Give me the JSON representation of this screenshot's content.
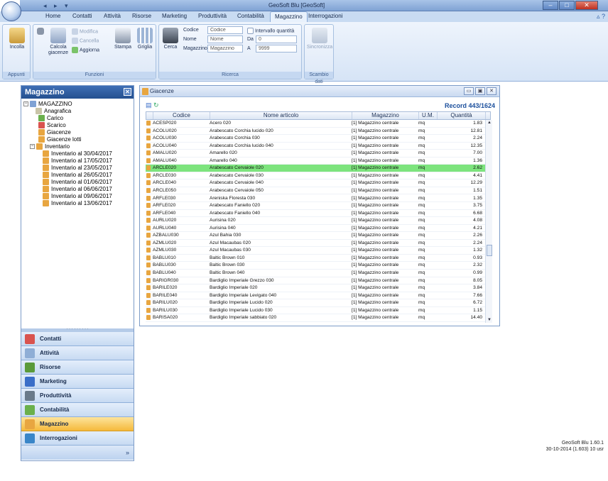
{
  "titlebar": {
    "title": "GeoSoft Blu [GeoSoft]"
  },
  "tabs": [
    {
      "label": "Home"
    },
    {
      "label": "Contatti"
    },
    {
      "label": "Attività"
    },
    {
      "label": "Risorse"
    },
    {
      "label": "Marketing"
    },
    {
      "label": "Produttività"
    },
    {
      "label": "Contabilità"
    },
    {
      "label": "Magazzino"
    },
    {
      "label": "Interrogazioni"
    }
  ],
  "ribbon": {
    "appunti": {
      "title": "Appunti",
      "incolla": "Incolla"
    },
    "funzioni": {
      "title": "Funzioni",
      "modifica": "Modifica",
      "cancella": "Cancella",
      "aggiorna": "Aggiorna",
      "calcola_giacenze": "Calcola giacenze",
      "stampa": "Stampa",
      "griglia": "Griglia"
    },
    "ricerca": {
      "title": "Ricerca",
      "cerca": "Cerca",
      "codice_label": "Codice",
      "codice_value": "Codice",
      "nome_label": "Nome",
      "nome_value": "Nome",
      "magazzino_label": "Magazzino",
      "magazzino_value": "Magazzino",
      "intervallo_label": "Intervallo quantità",
      "da_label": "Da",
      "da_value": "0",
      "a_label": "A",
      "a_value": "9999"
    },
    "scambio": {
      "title": "Scambio dati",
      "sincronizza": "Sincronizza"
    }
  },
  "left_panel": {
    "title": "Magazzino",
    "tree": [
      {
        "label": "MAGAZZINO"
      },
      {
        "label": "Anagrafica"
      },
      {
        "label": "Carico"
      },
      {
        "label": "Scarico"
      },
      {
        "label": "Giacenze"
      },
      {
        "label": "Giacenze lotti"
      },
      {
        "label": "Inventario"
      },
      {
        "label": "Inventario al 30/04/2017"
      },
      {
        "label": "Inventario al 17/05/2017"
      },
      {
        "label": "Inventario al 23/05/2017"
      },
      {
        "label": "Inventario al 26/05/2017"
      },
      {
        "label": "Inventario al 01/06/2017"
      },
      {
        "label": "Inventario al 06/06/2017"
      },
      {
        "label": "Inventario al 09/06/2017"
      },
      {
        "label": "Inventario al 13/06/2017"
      }
    ],
    "nav": [
      {
        "label": "Contatti",
        "color": "#d9534f"
      },
      {
        "label": "Attività",
        "color": "#8faed6"
      },
      {
        "label": "Risorse",
        "color": "#5a9a3a"
      },
      {
        "label": "Marketing",
        "color": "#3a6ec8"
      },
      {
        "label": "Produttività",
        "color": "#6a7a8a"
      },
      {
        "label": "Contabilità",
        "color": "#6ab04c"
      },
      {
        "label": "Magazzino",
        "color": "#e8a640"
      },
      {
        "label": "Interrogazioni",
        "color": "#3a86c8"
      }
    ]
  },
  "grid_window": {
    "title": "Giacenze",
    "record": "Record 443/1624",
    "columns": [
      "Codice",
      "Nome articolo",
      "Magazzino",
      "U.M.",
      "Quantità"
    ],
    "rows": [
      [
        "ACESP020",
        "Acero 020",
        "[1] Magazzino centrale",
        "mq",
        "1.83"
      ],
      [
        "ACOLU020",
        "Arabescato Corchia lucido 020",
        "[1] Magazzino centrale",
        "mq",
        "12.81"
      ],
      [
        "ACOLU030",
        "Arabescato Corchia 030",
        "[1] Magazzino centrale",
        "mq",
        "2.24"
      ],
      [
        "ACOLU040",
        "Arabescato Corchia lucido 040",
        "[1] Magazzino centrale",
        "mq",
        "12.35"
      ],
      [
        "AMALU020",
        "Amarello 020",
        "[1] Magazzino centrale",
        "mq",
        "7.00"
      ],
      [
        "AMALU040",
        "Amarello 040",
        "[1] Magazzino centrale",
        "mq",
        "1.36"
      ],
      [
        "ARCLE020",
        "Arabescato Cervaiole 020",
        "[1] Magazzino centrale",
        "mq",
        "2.62"
      ],
      [
        "ARCLE030",
        "Arabescato Cervaiole 030",
        "[1] Magazzino centrale",
        "mq",
        "4.41"
      ],
      [
        "ARCLE040",
        "Arabescato Cervaiole 040",
        "[1] Magazzino centrale",
        "mq",
        "12.29"
      ],
      [
        "ARCLE050",
        "Arabescato Cervaiole 050",
        "[1] Magazzino centrale",
        "mq",
        "1.51"
      ],
      [
        "ARFLE030",
        "Areniska Floresta 030",
        "[1] Magazzino centrale",
        "mq",
        "1.35"
      ],
      [
        "ARFLE020",
        "Arabescato Faniello 020",
        "[1] Magazzino centrale",
        "mq",
        "3.75"
      ],
      [
        "ARFLE040",
        "Arabescato Faniello 040",
        "[1] Magazzino centrale",
        "mq",
        "6.68"
      ],
      [
        "AURLU020",
        "Aurisina 020",
        "[1] Magazzino centrale",
        "mq",
        "4.08"
      ],
      [
        "AURLU040",
        "Aurisina 040",
        "[1] Magazzino centrale",
        "mq",
        "4.21"
      ],
      [
        "AZBALU030",
        "Azul Bahia 030",
        "[1] Magazzino centrale",
        "mq",
        "2.26"
      ],
      [
        "AZMLU020",
        "Azul Macaubas 020",
        "[1] Magazzino centrale",
        "mq",
        "2.24"
      ],
      [
        "AZMLU030",
        "Azul Macaubas 030",
        "[1] Magazzino centrale",
        "mq",
        "1.32"
      ],
      [
        "BABLU010",
        "Baltic Brown 010",
        "[1] Magazzino centrale",
        "mq",
        "0.93"
      ],
      [
        "BABLU030",
        "Baltic Brown 030",
        "[1] Magazzino centrale",
        "mq",
        "2.32"
      ],
      [
        "BABLU040",
        "Baltic Brown 040",
        "[1] Magazzino centrale",
        "mq",
        "0.99"
      ],
      [
        "BARIGR030",
        "Bardiglio Imperiale Grezzo 030",
        "[1] Magazzino centrale",
        "mq",
        "8.05"
      ],
      [
        "BARILE020",
        "Bardiglio Imperiale 020",
        "[1] Magazzino centrale",
        "mq",
        "3.84"
      ],
      [
        "BARILE040",
        "Bardiglio Imperiale Levigato 040",
        "[1] Magazzino centrale",
        "mq",
        "7.66"
      ],
      [
        "BARILU020",
        "Bardiglio Imperiale Lucido 020",
        "[1] Magazzino centrale",
        "mq",
        "6.72"
      ],
      [
        "BARILU030",
        "Bardiglio Imperiale Lucido 030",
        "[1] Magazzino centrale",
        "mq",
        "1.15"
      ],
      [
        "BARISA020",
        "Bardiglio Imperiale sabbiato 020",
        "[1] Magazzino centrale",
        "mq",
        "14.40"
      ]
    ],
    "selected_row": 6
  },
  "footer": {
    "line1": "GeoSoft Blu 1.60.1",
    "line2": "30-10-2014 (1.603) 10 usr"
  }
}
